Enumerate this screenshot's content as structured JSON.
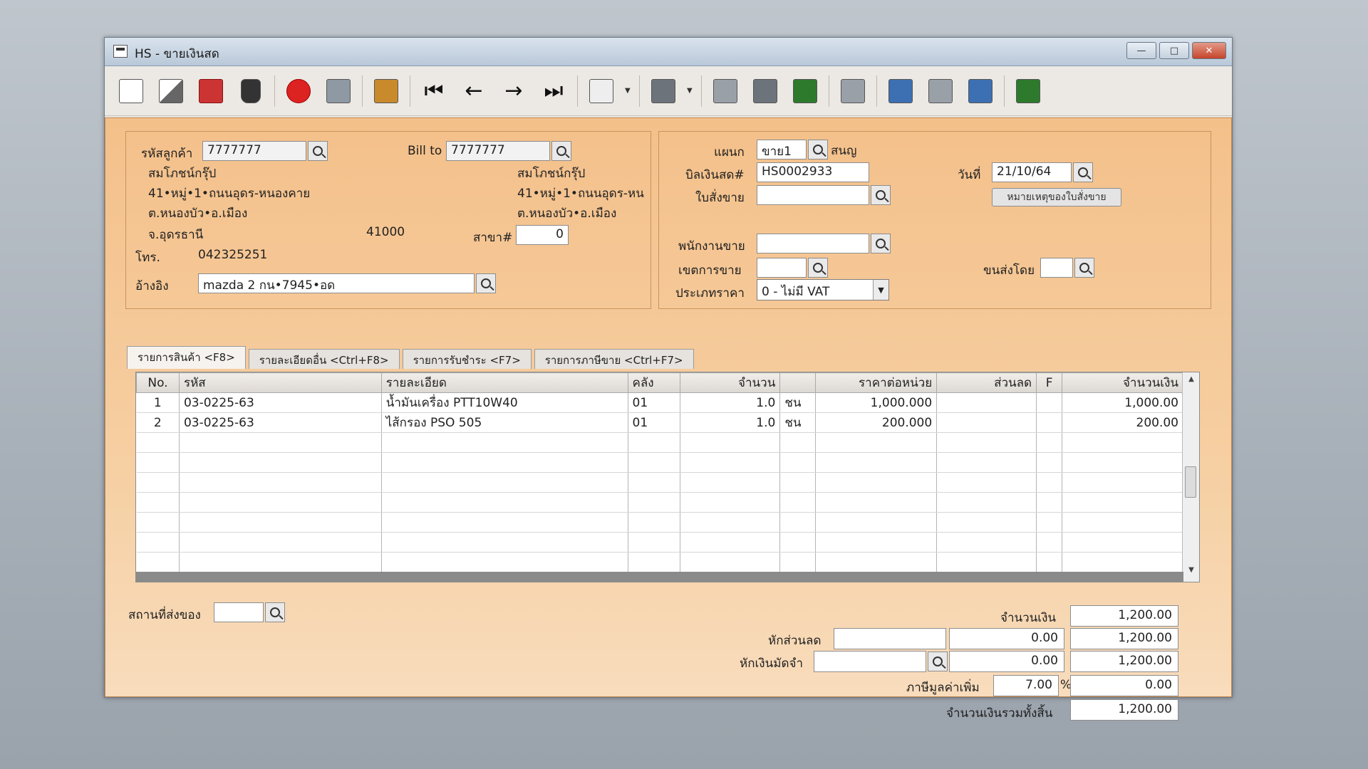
{
  "window": {
    "title": "HS - ขายเงินสด",
    "controls": {
      "minimize": "—",
      "maximize": "□",
      "close": "✕"
    }
  },
  "toolbar": {
    "icons": [
      "new-doc-icon",
      "edit-icon",
      "void-icon",
      "trash-icon",
      "cancel-icon",
      "save-icon",
      "money-icon",
      "first-icon",
      "prev-icon",
      "next-icon",
      "last-icon",
      "find-icon",
      "print-icon",
      "report1-icon",
      "report2-icon",
      "report3-icon",
      "calendar-icon",
      "approve-icon",
      "tools-icon",
      "ok-icon",
      "export-icon"
    ]
  },
  "customer": {
    "code_label": "รหัสลูกค้า",
    "code_value": "7777777",
    "name": "สมโภชน์กรุ๊ป",
    "address1": "41•หมู่•1•ถนนอุดร-หนองคาย",
    "address2": "ต.หนองบัว•อ.เมือง",
    "province": "จ.อุดรธานี",
    "postcode": "41000",
    "phone_label": "โทร.",
    "phone": "042325251",
    "ref_label": "อ้างอิง",
    "ref_value": "mazda 2 กน•7945•อด"
  },
  "bill_to": {
    "label": "Bill to",
    "value": "7777777",
    "name": "สมโภชน์กรุ๊ป",
    "address1": "41•หมู่•1•ถนนอุดร-หน",
    "address2": "ต.หนองบัว•อ.เมือง",
    "branch_label": "สาขา#",
    "branch_value": "0"
  },
  "doc": {
    "dept_label": "แผนก",
    "dept_value": "ขาย1",
    "dept_name": "สนญ",
    "bill_label": "บิลเงินสด#",
    "bill_value": "HS0002933",
    "date_label": "วันที่",
    "date_value": "21/10/64",
    "so_label": "ใบสั่งขาย",
    "so_value": "",
    "note_button": "หมายเหตุของใบสั่งขาย",
    "sales_label": "พนักงานขาย",
    "sales_value": "",
    "area_label": "เขตการขาย",
    "area_value": "",
    "ship_label": "ขนส่งโดย",
    "ship_value": "",
    "price_type_label": "ประเภทราคา",
    "price_type_value": "0 - ไม่มี VAT"
  },
  "tabs": [
    {
      "label": "รายการสินค้า <F8>"
    },
    {
      "label": "รายละเอียดอื่น <Ctrl+F8>"
    },
    {
      "label": "รายการรับชำระ <F7>"
    },
    {
      "label": "รายการภาษีขาย <Ctrl+F7>"
    }
  ],
  "grid": {
    "headers": [
      "No.",
      "รหัส",
      "รายละเอียด",
      "คลัง",
      "จำนวน",
      "",
      "ราคาต่อหน่วย",
      "ส่วนลด",
      "F",
      "จำนวนเงิน"
    ],
    "rows": [
      [
        "1",
        "03-0225-63",
        "น้ำมันเครื่อง PTT10W40",
        "01",
        "1.0",
        "ชน",
        "1,000.000",
        "",
        "",
        "1,000.00"
      ],
      [
        "2",
        "03-0225-63",
        "ไส้กรอง PSO 505",
        "01",
        "1.0",
        "ชน",
        "200.000",
        "",
        "",
        "200.00"
      ]
    ]
  },
  "footer": {
    "ship_place_label": "สถานที่ส่งของ",
    "ship_place_value": "",
    "amount_label": "จำนวนเงิน",
    "amount_value": "1,200.00",
    "discount_label": "หักส่วนลด",
    "discount_input": "",
    "discount_value": "0.00",
    "discount_total": "1,200.00",
    "deposit_label": "หักเงินมัดจำ",
    "deposit_input": "",
    "deposit_value": "0.00",
    "deposit_total": "1,200.00",
    "vat_label": "ภาษีมูลค่าเพิ่ม",
    "vat_rate": "7.00",
    "vat_pct": "%",
    "vat_value": "0.00",
    "grand_label": "จำนวนเงินรวมทั้งสิ้น",
    "grand_value": "1,200.00"
  }
}
